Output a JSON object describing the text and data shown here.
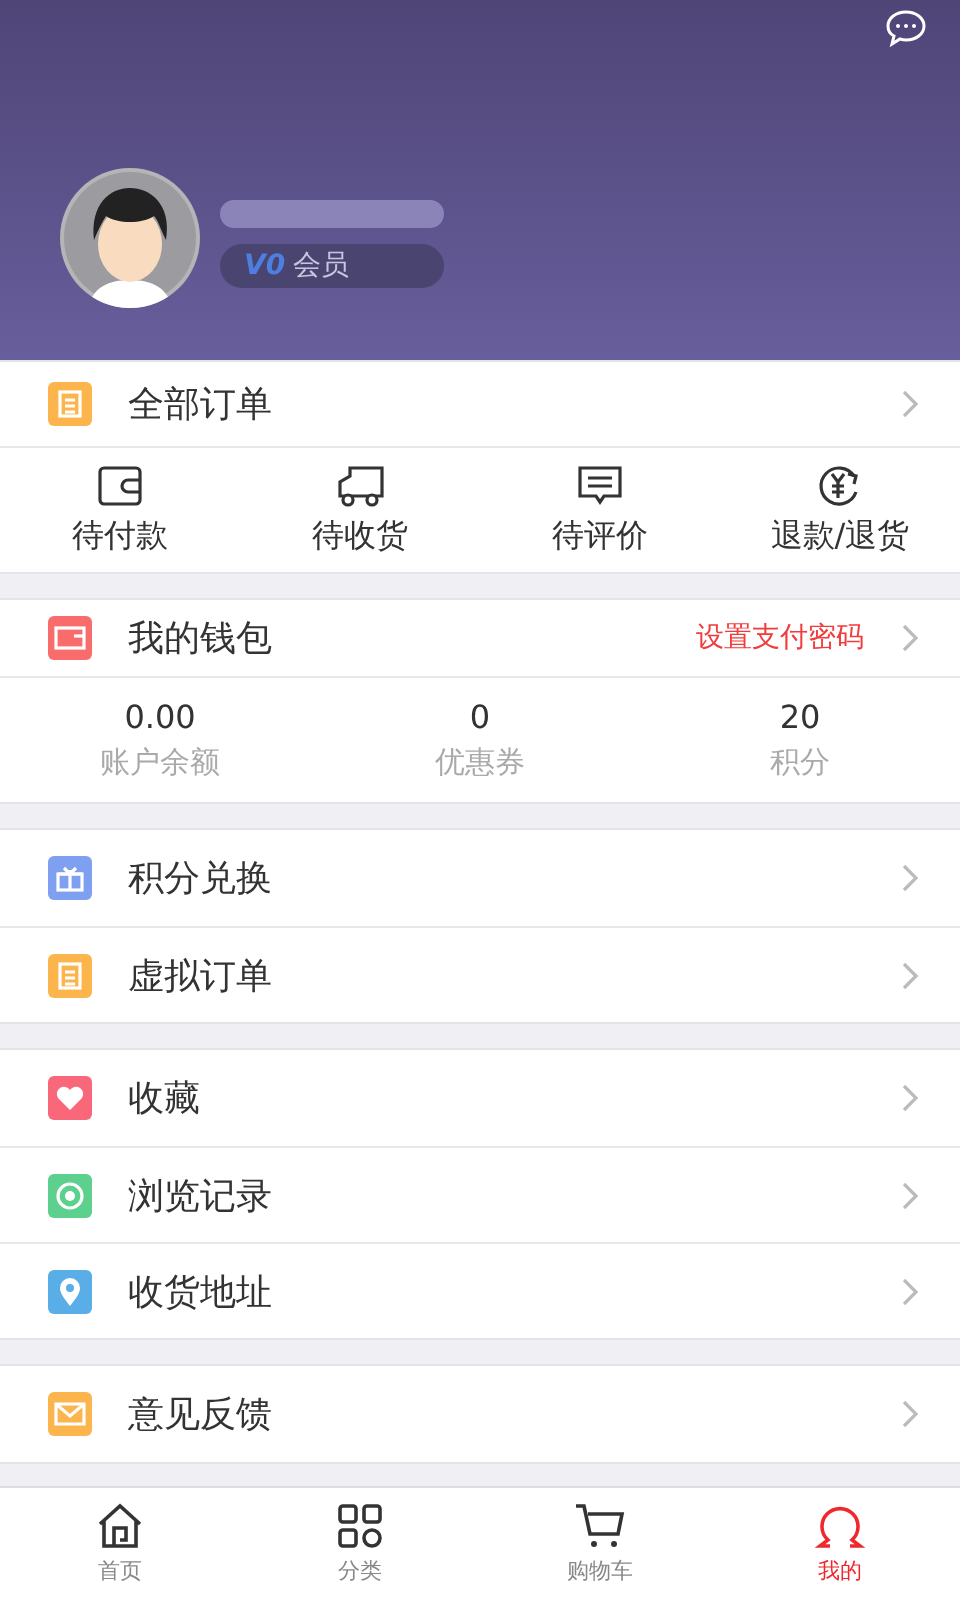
{
  "profile": {
    "badge_level": "V0",
    "badge": "会员"
  },
  "orders": {
    "title": "全部订单",
    "actions": [
      {
        "kind": "wallet",
        "label": "待付款"
      },
      {
        "kind": "truck",
        "label": "待收货"
      },
      {
        "kind": "comment",
        "label": "待评价"
      },
      {
        "kind": "refund",
        "label": "退款/退货"
      }
    ]
  },
  "wallet": {
    "title": "我的钱包",
    "link": "设置支付密码",
    "stats": [
      {
        "value": "0.00",
        "label": "账户余额"
      },
      {
        "value": "0",
        "label": "优惠券"
      },
      {
        "value": "20",
        "label": "积分"
      }
    ]
  },
  "menu_groups": [
    [
      {
        "kind": "gift",
        "label": "积分兑换",
        "color": "#7f9ff0"
      },
      {
        "kind": "clipboard",
        "label": "虚拟订单",
        "color": "#fbb54c"
      }
    ],
    [
      {
        "kind": "heart",
        "label": "收藏",
        "color": "#f8687a"
      },
      {
        "kind": "eye",
        "label": "浏览记录",
        "color": "#5cd08c"
      },
      {
        "kind": "pin",
        "label": "收货地址",
        "color": "#5aaee8"
      }
    ],
    [
      {
        "kind": "mail",
        "label": "意见反馈",
        "color": "#fbb54c"
      }
    ]
  ],
  "tabbar": [
    {
      "kind": "home",
      "label": "首页",
      "selected": false
    },
    {
      "kind": "grid",
      "label": "分类",
      "selected": false
    },
    {
      "kind": "cart",
      "label": "购物车",
      "selected": false
    },
    {
      "kind": "user",
      "label": "我的",
      "selected": true
    }
  ]
}
